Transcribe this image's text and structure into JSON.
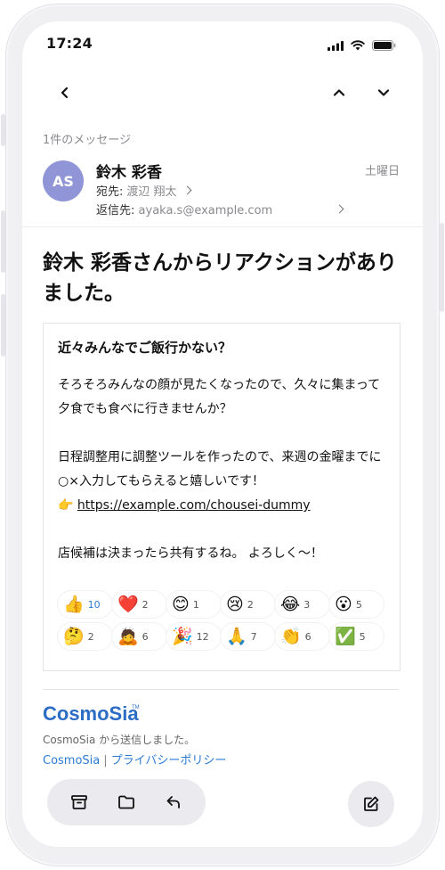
{
  "status_bar": {
    "time": "17:24"
  },
  "navigation": {
    "back_icon": "chevron-left-icon",
    "prev_icon": "chevron-up-icon",
    "next_icon": "chevron-down-icon"
  },
  "message_meta": {
    "count_label": "1件のメッセージ",
    "avatar_initials": "AS",
    "avatar_color": "#8f95d6",
    "sender_name": "鈴木 彩香",
    "date": "土曜日",
    "to_label": "宛先:",
    "to_value": "渡辺 翔太",
    "reply_to_label": "返信先:",
    "reply_to_value": "ayaka.s@example.com"
  },
  "email": {
    "headline": "鈴木 彩香さんからリアクションがありました。",
    "card_title": "近々みんなでご飯行かない？",
    "paragraph1": "そろそろみんなの顔が見たくなったので、久々に集まって夕食でも食べに行きませんか？",
    "paragraph2": "日程調整用に調整ツールを作ったので、来週の金曜までに○×入力してもらえると嬉しいです！",
    "pointer_emoji": "👉",
    "link": "https://example.com/chousei-dummy",
    "paragraph3": "店候補は決まったら共有するね。 よろしく〜！",
    "reactions": [
      {
        "emoji": "👍",
        "count": "10",
        "highlight": true
      },
      {
        "emoji": "❤️",
        "count": "2",
        "highlight": false
      },
      {
        "emoji": "😊",
        "count": "1",
        "highlight": false
      },
      {
        "emoji": "😢",
        "count": "2",
        "highlight": false
      },
      {
        "emoji": "😂",
        "count": "3",
        "highlight": false
      },
      {
        "emoji": "😮",
        "count": "5",
        "highlight": false
      },
      {
        "emoji": "🤔",
        "count": "2",
        "highlight": false
      },
      {
        "emoji": "🙇",
        "count": "6",
        "highlight": false
      },
      {
        "emoji": "🎉",
        "count": "12",
        "highlight": false
      },
      {
        "emoji": "🙏",
        "count": "7",
        "highlight": false
      },
      {
        "emoji": "👏",
        "count": "6",
        "highlight": false
      },
      {
        "emoji": "✅",
        "count": "5",
        "highlight": false
      }
    ]
  },
  "footer": {
    "brand": "CosmoSia",
    "trademark": "TM",
    "sent_from": "CosmoSia から送信しました。",
    "link_brand": "CosmoSia",
    "separator": "|",
    "link_privacy": "プライバシーポリシー",
    "brand_color": "#2b6cc4"
  },
  "bottom_toolbar": {
    "archive_icon": "archive-icon",
    "folder_icon": "folder-icon",
    "reply_icon": "reply-icon",
    "compose_icon": "compose-icon"
  }
}
